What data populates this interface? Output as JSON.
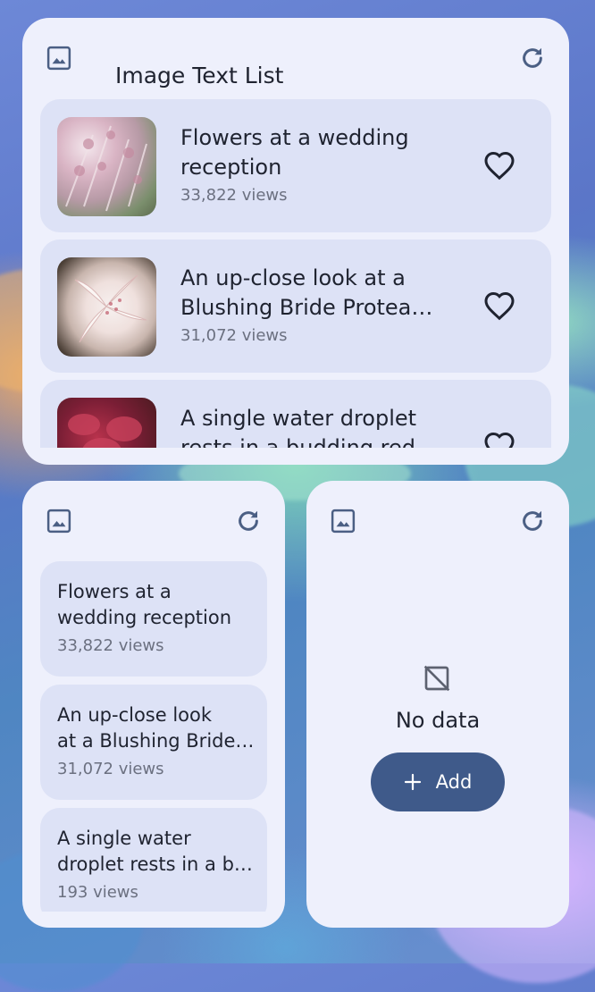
{
  "colors": {
    "widget_bg": "#eef0fc",
    "card_bg": "#dde2f6",
    "icon": "#4b5f84",
    "button_bg": "#3f5a8a",
    "button_text": "#ffffff"
  },
  "large_widget": {
    "title": "Image Text List",
    "header_icon": "image-icon",
    "refresh_icon": "refresh-icon",
    "items": [
      {
        "title": "Flowers at a wedding reception",
        "views": "33,822 views",
        "icon": "heart-outline-icon"
      },
      {
        "title": "An up-close look at a Blushing Bride Protea flower",
        "views": "31,072 views",
        "icon": "heart-outline-icon"
      },
      {
        "title": "A single water droplet rests in a budding red",
        "views": "",
        "icon": "heart-outline-icon"
      }
    ]
  },
  "small_list_widget": {
    "header_icon": "image-icon",
    "refresh_icon": "refresh-icon",
    "items": [
      {
        "line1": "Flowers at a",
        "line2": "wedding reception",
        "views": "33,822 views"
      },
      {
        "line1": "An up-close look",
        "line2": "at a Blushing Bride flower",
        "views": "31,072 views"
      },
      {
        "line1": "A single water",
        "line2": "droplet rests in a budding",
        "views": "193 views"
      }
    ]
  },
  "empty_widget": {
    "header_icon": "image-icon",
    "refresh_icon": "refresh-icon",
    "empty_icon": "image-not-supported-icon",
    "message": "No data",
    "add_label": "Add"
  }
}
